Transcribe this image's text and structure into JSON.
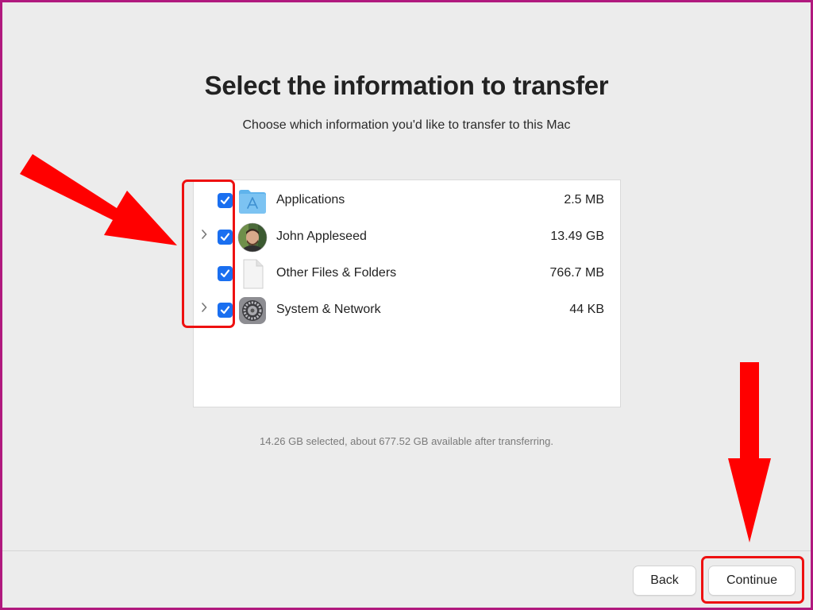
{
  "header": {
    "title": "Select the information to transfer",
    "subtitle": "Choose which information you'd like to transfer to this Mac"
  },
  "items": [
    {
      "label": "Applications",
      "size": "2.5 MB",
      "checked": true,
      "expandable": false,
      "icon": "applications-folder-icon"
    },
    {
      "label": "John Appleseed",
      "size": "13.49 GB",
      "checked": true,
      "expandable": true,
      "icon": "user-avatar-icon"
    },
    {
      "label": "Other Files & Folders",
      "size": "766.7 MB",
      "checked": true,
      "expandable": false,
      "icon": "document-icon"
    },
    {
      "label": "System & Network",
      "size": "44 KB",
      "checked": true,
      "expandable": true,
      "icon": "system-settings-gear-icon"
    }
  ],
  "summary": "14.26 GB selected, about 677.52 GB available after transferring.",
  "buttons": {
    "back": "Back",
    "continue": "Continue"
  },
  "colors": {
    "checkbox": "#1a6ff0",
    "annotation": "#ff0000",
    "frame_border": "#b0197e",
    "background": "#ececec"
  }
}
